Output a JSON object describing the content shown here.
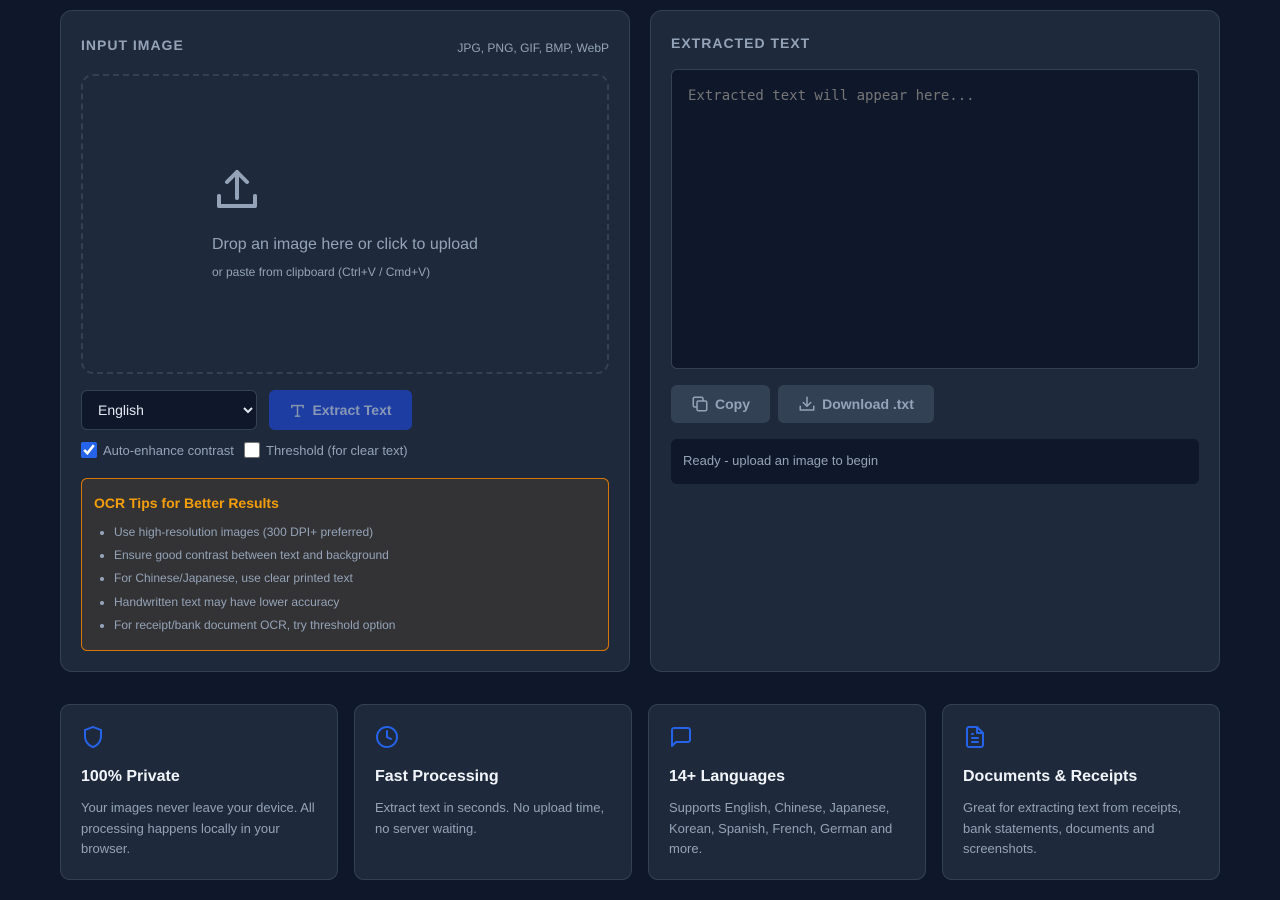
{
  "input_panel": {
    "title": "INPUT IMAGE",
    "formats": "JPG, PNG, GIF, BMP, WebP",
    "dropzone": {
      "icon": "upload-icon",
      "text": "Drop an image here or click to upload",
      "subtext": "or paste from clipboard (Ctrl+V / Cmd+V)"
    },
    "language": {
      "selected": "English"
    },
    "extract_button": {
      "label": "Extract Text",
      "icon": "text-icon"
    },
    "options": {
      "auto_enhance": {
        "label": "Auto-enhance contrast",
        "checked": true
      },
      "threshold": {
        "label": "Threshold (for clear text)",
        "checked": false
      }
    },
    "tips": {
      "title": "OCR Tips for Better Results",
      "items": [
        "Use high-resolution images (300 DPI+ preferred)",
        "Ensure good contrast between text and background",
        "For Chinese/Japanese, use clear printed text",
        "Handwritten text may have lower accuracy",
        "For receipt/bank document OCR, try threshold option"
      ]
    }
  },
  "output_panel": {
    "title": "EXTRACTED TEXT",
    "textarea_placeholder": "Extracted text will appear here...",
    "copy_button": {
      "label": "Copy",
      "icon": "copy-icon"
    },
    "download_button": {
      "label": "Download .txt",
      "icon": "download-icon"
    },
    "status": "Ready - upload an image to begin"
  },
  "features": [
    {
      "icon": "shield-icon",
      "title": "100% Private",
      "description": "Your images never leave your device. All processing happens locally in your browser."
    },
    {
      "icon": "clock-icon",
      "title": "Fast Processing",
      "description": "Extract text in seconds. No upload time, no server waiting."
    },
    {
      "icon": "chat-bubble-icon",
      "title": "14+ Languages",
      "description": "Supports English, Chinese, Japanese, Korean, Spanish, French, German and more."
    },
    {
      "icon": "document-icon",
      "title": "Documents & Receipts",
      "description": "Great for extracting text from receipts, bank statements, documents and screenshots."
    }
  ],
  "colors": {
    "background": "#0f172a",
    "panel": "#1e293b",
    "accent": "#2563eb",
    "tips_border": "#d97706",
    "tips_title": "#f59e0b"
  }
}
